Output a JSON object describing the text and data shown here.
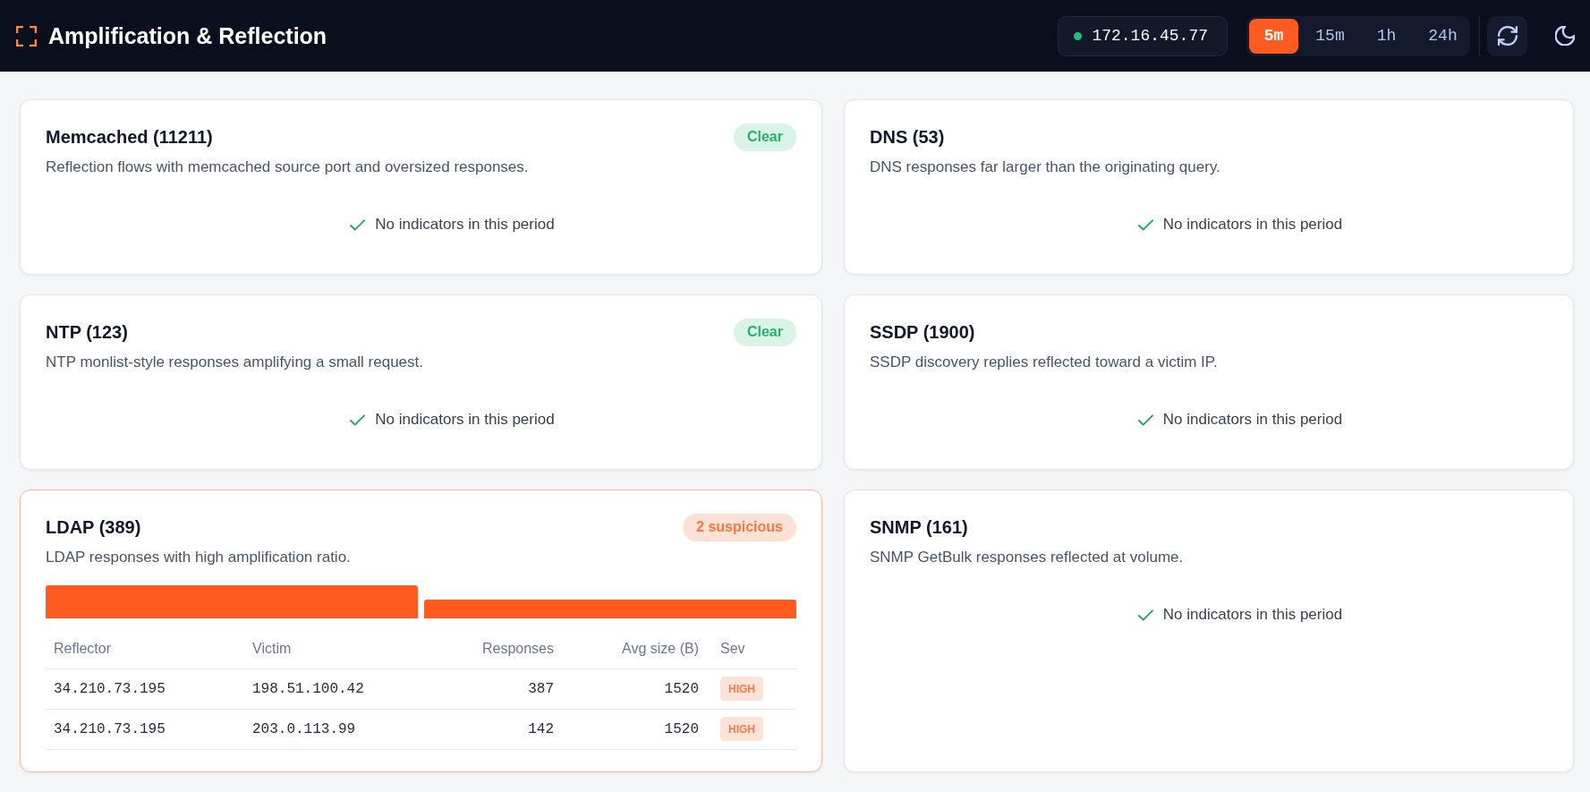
{
  "header": {
    "title": "Amplification & Reflection",
    "host": {
      "address": "172.16.45.77",
      "connected": true
    },
    "ranges": [
      {
        "label": "5m",
        "selected": true
      },
      {
        "label": "15m",
        "selected": false
      },
      {
        "label": "1h",
        "selected": false
      },
      {
        "label": "24h",
        "selected": false
      }
    ]
  },
  "cards": [
    {
      "title": "Memcached (11211)",
      "description": "Reflection flows with memcached source port and oversized responses.",
      "flagged": false,
      "badge": {
        "text": "Clear",
        "kind": "clear"
      },
      "empty_message": "No indicators in this period"
    },
    {
      "title": "DNS (53)",
      "description": "DNS responses far larger than the originating query.",
      "flagged": false,
      "empty_message": "No indicators in this period"
    },
    {
      "title": "NTP (123)",
      "description": "NTP monlist-style responses amplifying a small request.",
      "flagged": false,
      "badge": {
        "text": "Clear",
        "kind": "clear"
      },
      "empty_message": "No indicators in this period"
    },
    {
      "title": "SSDP (1900)",
      "description": "SSDP discovery replies reflected toward a victim IP.",
      "flagged": false,
      "empty_message": "No indicators in this period"
    },
    {
      "title": "LDAP (389)",
      "description": "LDAP responses with high amplification ratio.",
      "flagged": true,
      "badge": {
        "text": "2 suspicious",
        "kind": "alert"
      },
      "table": {
        "columns": [
          {
            "label": "Reflector",
            "kind": "address"
          },
          {
            "label": "Victim",
            "kind": "address"
          },
          {
            "label": "Responses",
            "kind": "number"
          },
          {
            "label": "Avg size (B)",
            "kind": "number"
          },
          {
            "label": "Sev",
            "kind": "severity"
          }
        ],
        "rows": [
          [
            "34.210.73.195",
            "198.51.100.42",
            "387",
            "1520",
            "HIGH"
          ],
          [
            "34.210.73.195",
            "203.0.113.99",
            "142",
            "1520",
            "HIGH"
          ]
        ]
      }
    },
    {
      "title": "SNMP (161)",
      "description": "SNMP GetBulk responses reflected at volume.",
      "flagged": false,
      "empty_message": "No indicators in this period"
    }
  ]
}
